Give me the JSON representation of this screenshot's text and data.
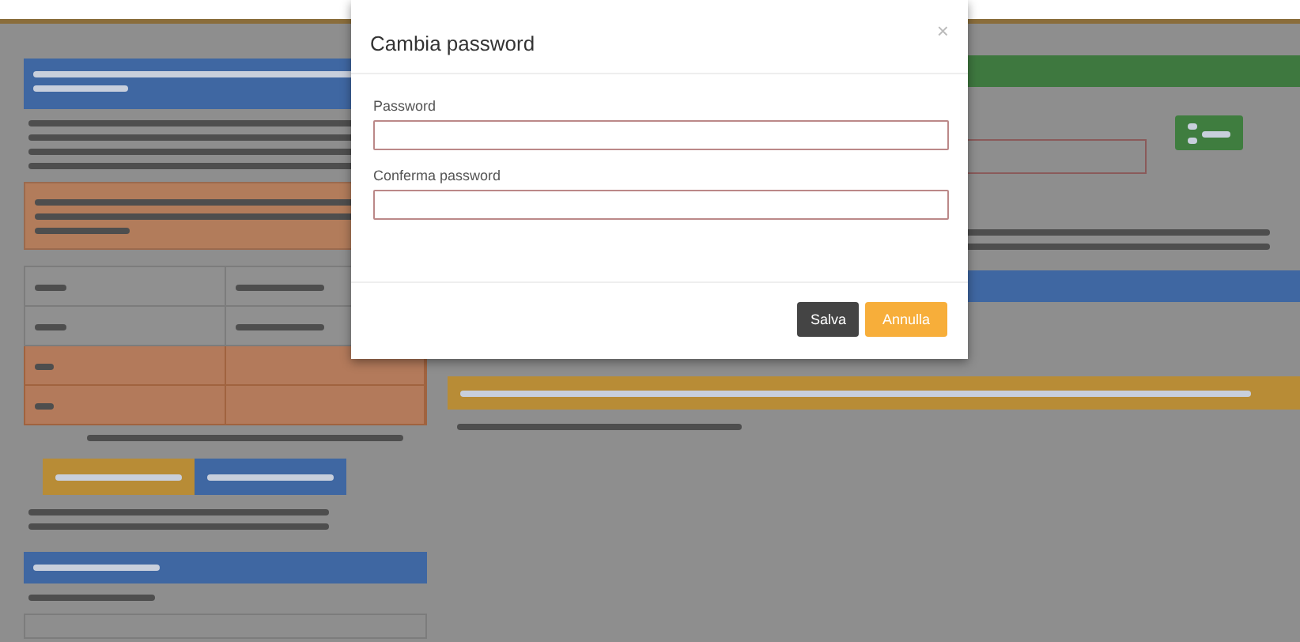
{
  "dialog": {
    "title": "Cambia password",
    "close": "×",
    "fields": [
      {
        "label": "Password"
      },
      {
        "label": "Conferma password"
      }
    ],
    "buttons": [
      {
        "label": "Salva",
        "kind": "primary"
      },
      {
        "label": "Annulla",
        "kind": "cancel"
      }
    ]
  },
  "background_table": {
    "rows": [
      {
        "invalid": false
      },
      {
        "invalid": false
      },
      {
        "invalid": true
      },
      {
        "invalid": true
      }
    ]
  }
}
